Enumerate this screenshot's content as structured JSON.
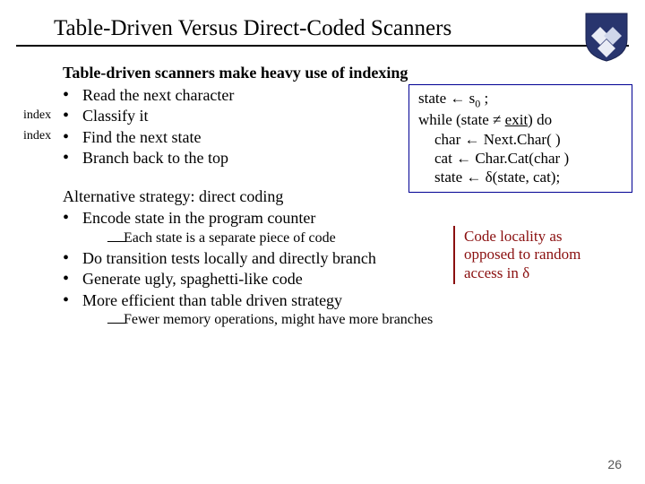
{
  "title": "Table-Driven Versus Direct-Coded Scanners",
  "logo_name": "shield-logo",
  "index_label_1": "index",
  "index_label_2": "index",
  "section1": {
    "lead": "Table-driven scanners make heavy use of indexing",
    "items": [
      "Read the next character",
      "Classify it",
      "Find the next state",
      "Branch back to the top"
    ]
  },
  "codebox": {
    "l1_a": "state ← s",
    "l1_sub": "0",
    "l1_b": " ;",
    "l2_a": "while (state ≠ ",
    "l2_u": "exit",
    "l2_b": ") do",
    "l3": "char ← Next.Char( )",
    "l4": "cat ← Char.Cat(char )",
    "l5": "state ← δ(state, cat);"
  },
  "note": {
    "l1": "Code locality as",
    "l2": "opposed to random",
    "l3": "access in δ"
  },
  "section2": {
    "lead": "Alternative strategy: direct coding",
    "item1": "Encode state in the program counter",
    "sub1": "Each state is a separate piece of code",
    "item2": "Do transition tests locally and directly branch",
    "item3": "Generate ugly, spaghetti-like code",
    "item4": "More efficient than table driven strategy",
    "sub2": "Fewer memory operations, might have more branches"
  },
  "page_number": "26"
}
